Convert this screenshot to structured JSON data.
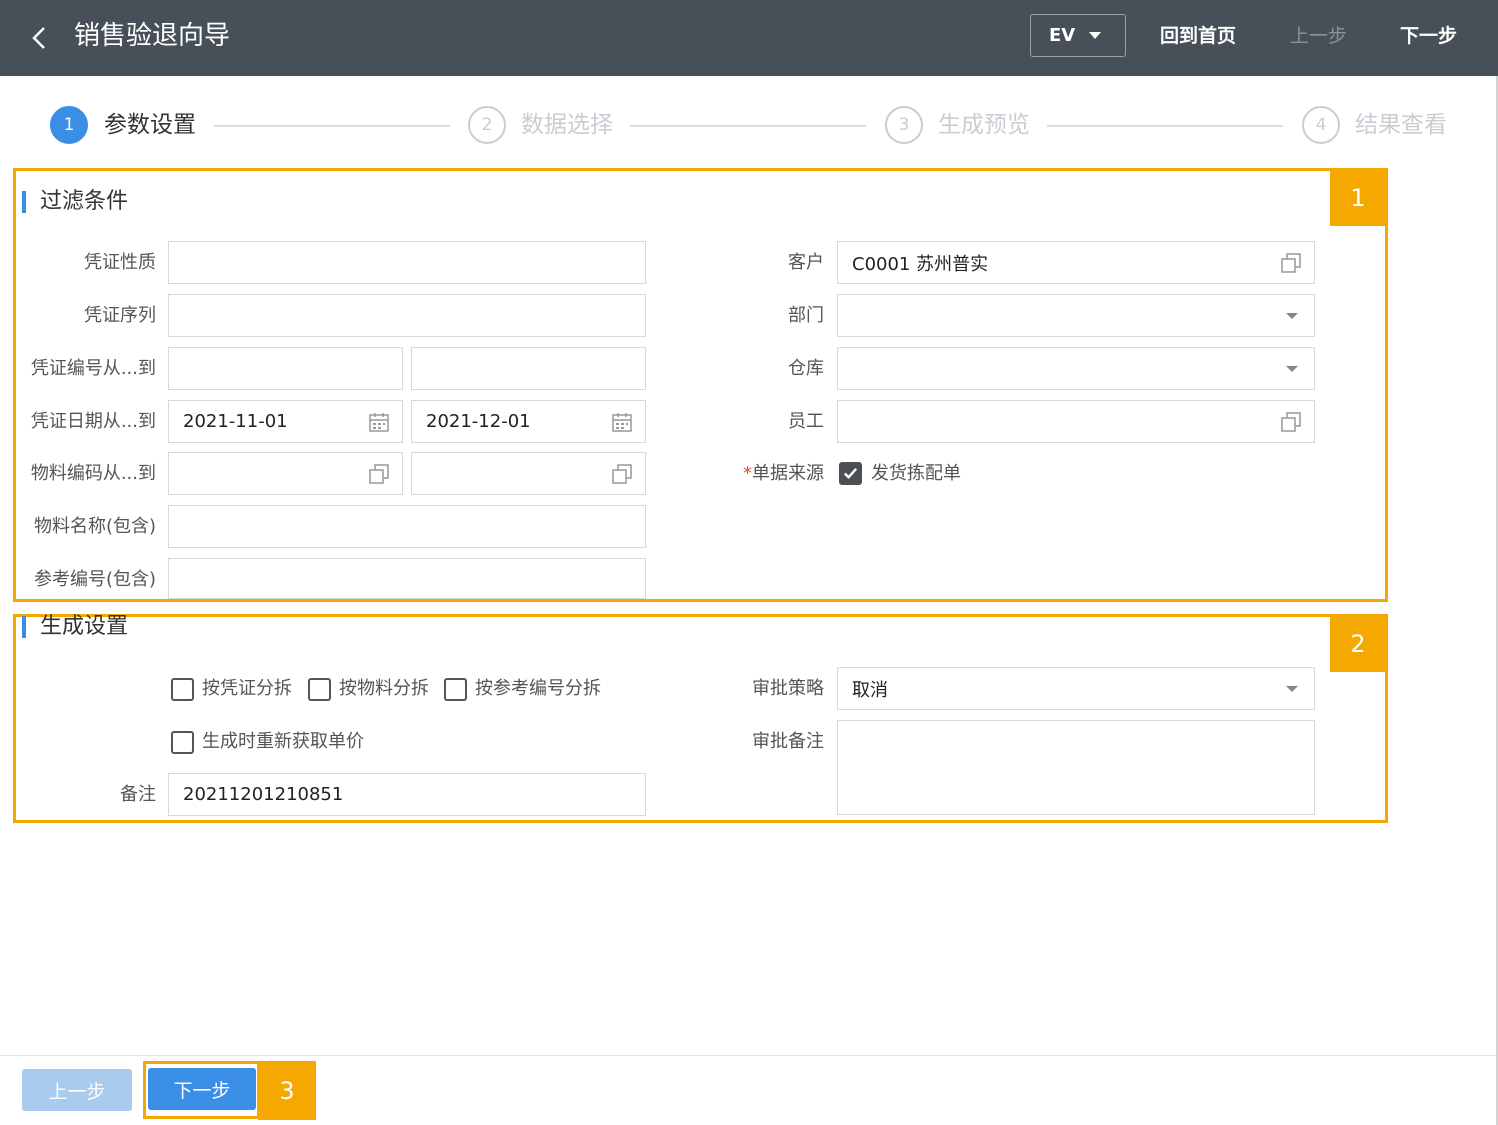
{
  "header": {
    "title": "销售验退向导",
    "ev_label": "EV",
    "home_label": "回到首页",
    "prev_label": "上一步",
    "next_label": "下一步"
  },
  "steps": [
    {
      "num": "1",
      "label": "参数设置",
      "active": true
    },
    {
      "num": "2",
      "label": "数据选择",
      "active": false
    },
    {
      "num": "3",
      "label": "生成预览",
      "active": false
    },
    {
      "num": "4",
      "label": "结果查看",
      "active": false
    }
  ],
  "filter": {
    "title": "过滤条件",
    "voucher_type_label": "凭证性质",
    "voucher_seq_label": "凭证序列",
    "voucher_no_label": "凭证编号从...到",
    "voucher_date_label": "凭证日期从...到",
    "date_from": "2021-11-01",
    "date_to": "2021-12-01",
    "material_code_label": "物料编码从...到",
    "material_name_label": "物料名称(包含)",
    "ref_no_label": "参考编号(包含)",
    "customer_label": "客户",
    "customer_value": "C0001 苏州普实",
    "dept_label": "部门",
    "warehouse_label": "仓库",
    "employee_label": "员工",
    "source_required_mark": "*",
    "source_label": "单据来源",
    "source_option": "发货拣配单"
  },
  "gen": {
    "title": "生成设置",
    "split_voucher": "按凭证分拆",
    "split_material": "按物料分拆",
    "split_ref": "按参考编号分拆",
    "refetch_price": "生成时重新获取单价",
    "remark_label": "备注",
    "remark_value": "20211201210851",
    "approval_strategy_label": "审批策略",
    "approval_strategy_value": "取消",
    "approval_note_label": "审批备注"
  },
  "footer": {
    "prev_label": "上一步",
    "next_label": "下一步"
  },
  "annotations": {
    "box1": "1",
    "box2": "2",
    "box3": "3"
  },
  "colors": {
    "header_bg": "#475059",
    "primary": "#3b8ee6",
    "highlight": "#f5a800"
  }
}
